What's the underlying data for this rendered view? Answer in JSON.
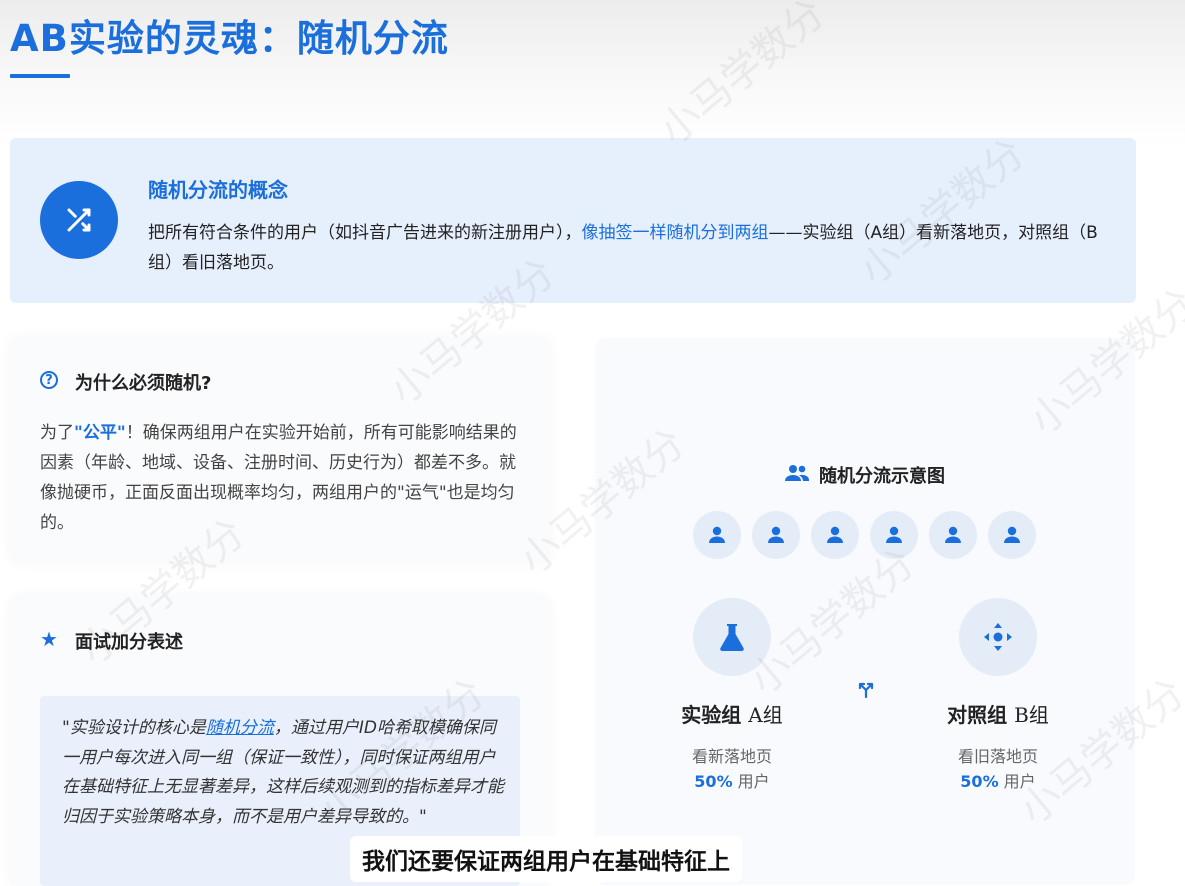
{
  "page": {
    "title": "AB实验的灵魂：随机分流"
  },
  "concept": {
    "title": "随机分流的概念",
    "body_part1": "把所有符合条件的用户（如抖音广告进来的新注册用户），",
    "body_highlight": "像抽签一样随机分到两组",
    "body_part2": "——实验组（A组）看新落地页，对照组（B组）看旧落地页。",
    "icon": "shuffle-icon"
  },
  "why": {
    "title": "为什么必须随机?",
    "body_prefix": "为了",
    "body_keyword": "\"公平\"",
    "body_rest": "！确保两组用户在实验开始前，所有可能影响结果的因素（年龄、地域、设备、注册时间、历史行为）都差不多。就像抛硬币，正面反面出现概率均匀，两组用户的\"运气\"也是均匀的。",
    "icon": "help-circle-icon"
  },
  "interview": {
    "title": "面试加分表述",
    "icon": "star-icon",
    "quote_part1": "\"实验设计的核心是",
    "quote_highlight": "随机分流",
    "quote_part2": "，通过用户ID哈希取模确保同一用户每次进入同一组（保证一致性），同时保证两组用户在基础特征上无显著差异，这样后续观测到的指标差异才能归因于实验策略本身，而不是用户差异导致的。\""
  },
  "diagram": {
    "title": "随机分流示意图",
    "title_icon": "users-icon",
    "users": [
      "user",
      "user",
      "user",
      "user",
      "user",
      "user"
    ],
    "group_a": {
      "label_prefix": "实验组 ",
      "label_letter": "A",
      "label_suffix": "组",
      "desc": "看新落地页",
      "pct": "50%",
      "pct_suffix": " 用户",
      "icon": "flask-icon"
    },
    "group_b": {
      "label_prefix": "对照组 ",
      "label_letter": "B",
      "label_suffix": "组",
      "desc": "看旧落地页",
      "pct": "50%",
      "pct_suffix": " 用户",
      "icon": "arrows-all-directions-icon"
    },
    "split_icon": "split-arrow-icon"
  },
  "subtitle": {
    "text": "我们还要保证两组用户在基础特征上"
  },
  "watermark": {
    "text": "小马学数分"
  },
  "colors": {
    "accent": "#1b6fdc",
    "banner_bg": "#e6effc",
    "quote_bg": "#e9f0fb"
  }
}
